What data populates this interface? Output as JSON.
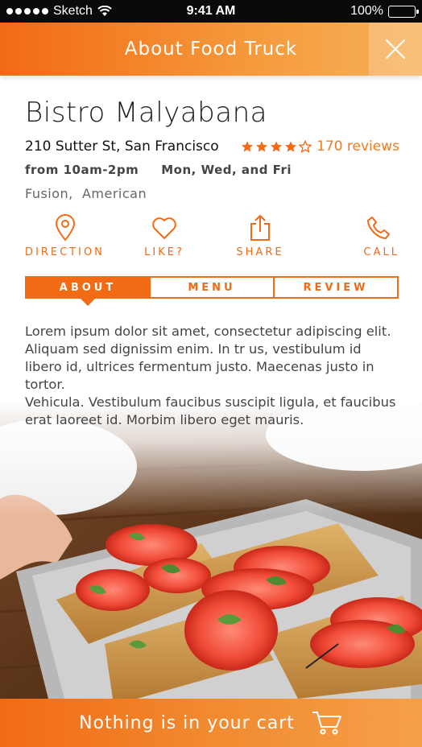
{
  "status": {
    "carrier": "Sketch",
    "time": "9:41 AM",
    "battery": "100%"
  },
  "header": {
    "title": "About Food Truck"
  },
  "truck": {
    "name": "Bistro Malyabana",
    "address": "210 Sutter St, San Francisco",
    "rating": 4,
    "rating_max": 5,
    "reviews_label": "170 reviews",
    "hours": "from 10am-2pm",
    "days": "Mon, Wed, and Fri",
    "cuisine": "Fusion,  American"
  },
  "actions": [
    {
      "label": "DIRECTION",
      "icon": "location-pin-icon"
    },
    {
      "label": "LIKE?",
      "icon": "heart-icon"
    },
    {
      "label": "SHARE",
      "icon": "share-icon"
    },
    {
      "label": "CALL",
      "icon": "phone-icon"
    }
  ],
  "tabs": [
    {
      "label": "ABOUT",
      "active": true
    },
    {
      "label": "MENU",
      "active": false
    },
    {
      "label": "REVIEW",
      "active": false
    }
  ],
  "about": {
    "paragraph1": "Lorem ipsum dolor sit amet, consectetur adipiscing elit. Aliquam sed dignissim enim. In tr us, vestibulum id libero id, ultrices fermentum justo. Maecenas justo in tortor.",
    "paragraph2": "Vehicula. Vestibulum faucibus suscipit ligula, et faucibus erat laoreet id. Morbim libero eget mauris."
  },
  "cart": {
    "message": "Nothing is in your cart",
    "icon": "cart-icon"
  },
  "colors": {
    "accent": "#f26a14",
    "accent_light": "#f7b25a"
  }
}
